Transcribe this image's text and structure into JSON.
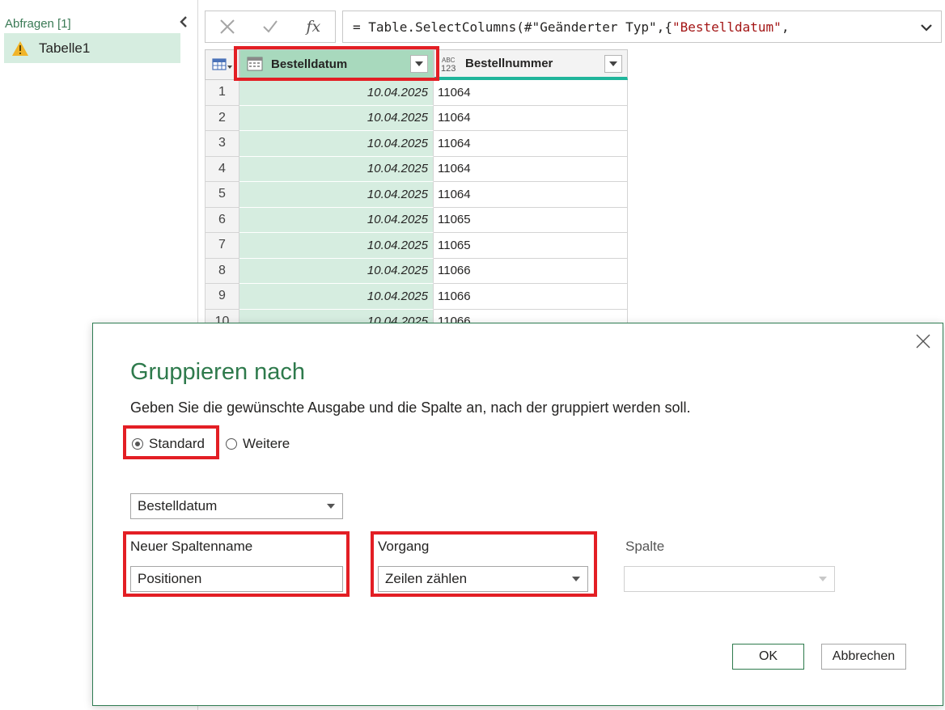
{
  "queries": {
    "header": "Abfragen [1]",
    "items": [
      {
        "label": "Tabelle1",
        "status": "warning"
      }
    ]
  },
  "formula": {
    "prefix": "= Table.SelectColumns(#\"Geänderter Typ\",{",
    "string": "\"Bestelldatum\"",
    "suffix": ","
  },
  "grid": {
    "columns": [
      {
        "name": "Bestelldatum",
        "type": "date",
        "selected": true
      },
      {
        "name": "Bestellnummer",
        "type": "any",
        "type_label_top": "ABC",
        "type_label_bottom": "123"
      }
    ],
    "rows": [
      {
        "n": "1",
        "date": "10.04.2025",
        "num": "11064"
      },
      {
        "n": "2",
        "date": "10.04.2025",
        "num": "11064"
      },
      {
        "n": "3",
        "date": "10.04.2025",
        "num": "11064"
      },
      {
        "n": "4",
        "date": "10.04.2025",
        "num": "11064"
      },
      {
        "n": "5",
        "date": "10.04.2025",
        "num": "11064"
      },
      {
        "n": "6",
        "date": "10.04.2025",
        "num": "11065"
      },
      {
        "n": "7",
        "date": "10.04.2025",
        "num": "11065"
      },
      {
        "n": "8",
        "date": "10.04.2025",
        "num": "11066"
      },
      {
        "n": "9",
        "date": "10.04.2025",
        "num": "11066"
      },
      {
        "n": "10",
        "date": "10.04.2025",
        "num": "11066"
      }
    ]
  },
  "dialog": {
    "title": "Gruppieren nach",
    "description": "Geben Sie die gewünschte Ausgabe und die Spalte an, nach der gruppiert werden soll.",
    "radio_standard": "Standard",
    "radio_advanced": "Weitere",
    "selected_mode": "standard",
    "group_by_column": "Bestelldatum",
    "new_column_label": "Neuer Spaltenname",
    "new_column_value": "Positionen",
    "operation_label": "Vorgang",
    "operation_value": "Zeilen zählen",
    "column_label": "Spalte",
    "column_value": "",
    "ok_label": "OK",
    "cancel_label": "Abbrechen"
  },
  "colors": {
    "accent_green": "#2e7a4c",
    "selection_fill": "#d6ede0",
    "highlight_red": "#e31e24"
  }
}
